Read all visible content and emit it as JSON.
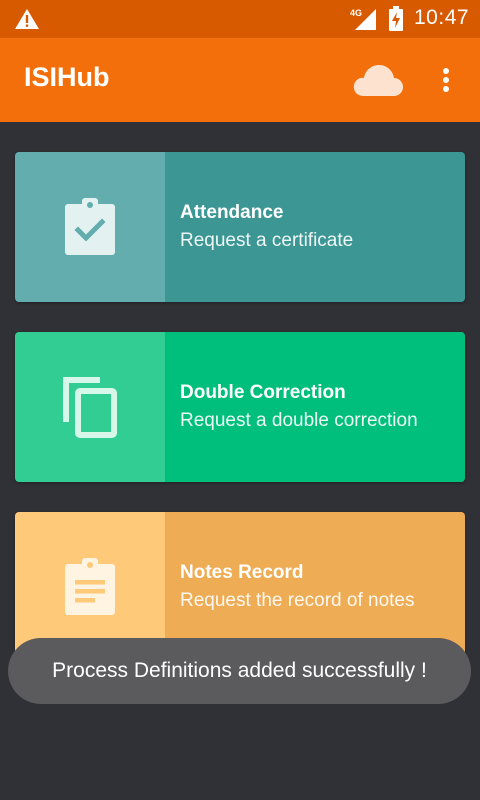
{
  "status_bar": {
    "time": "10:47",
    "network": "4G",
    "icons": [
      "warning-icon",
      "signal-icon",
      "battery-charging-icon"
    ]
  },
  "app_bar": {
    "title": "ISIHub",
    "icons": [
      "cloud-icon",
      "more-vert-icon"
    ]
  },
  "cards": [
    {
      "title": "Attendance",
      "subtitle": "Request a certificate",
      "icon": "assignment-turned-in-icon"
    },
    {
      "title": "Double Correction",
      "subtitle": "Request a double correction",
      "icon": "content-copy-icon"
    },
    {
      "title": "Notes Record",
      "subtitle": "Request the record of notes",
      "icon": "assignment-icon"
    }
  ],
  "toast": {
    "message": "Process Definitions added successfully !"
  },
  "colors": {
    "status_bar": "#d85a00",
    "app_bar": "#f26f0c",
    "background": "#303136",
    "attendance_icon_pane": "#63adae",
    "attendance_text_pane": "#3c9694",
    "double_icon_pane": "#32cd92",
    "double_text_pane": "#00bf7c",
    "notes_icon_pane": "#ffc97a",
    "notes_text_pane": "#eeac54"
  }
}
